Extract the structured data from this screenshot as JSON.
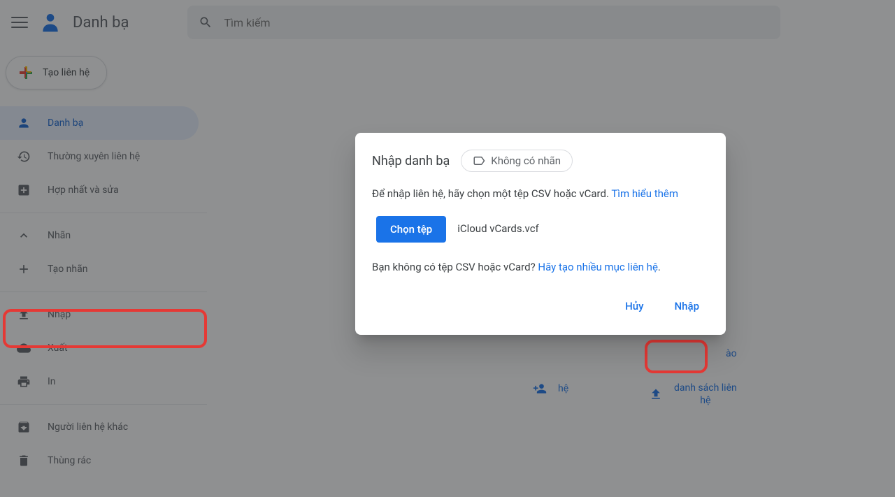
{
  "header": {
    "app_title": "Danh bạ",
    "search_placeholder": "Tìm kiếm"
  },
  "sidebar": {
    "create_label": "Tạo liên hệ",
    "items": {
      "contacts": "Danh bạ",
      "frequent": "Thường xuyên liên hệ",
      "merge": "Hợp nhất và sửa",
      "labels": "Nhãn",
      "create_label": "Tạo nhãn",
      "import": "Nhập",
      "export": "Xuất",
      "print": "In",
      "other": "Người liên hệ khác",
      "trash": "Thùng rác"
    }
  },
  "dialog": {
    "title": "Nhập danh bạ",
    "no_label_chip": "Không có nhãn",
    "desc_prefix": "Để nhập liên hệ, hãy chọn một tệp CSV hoặc vCard. ",
    "learn_more": "Tìm hiểu thêm",
    "choose_file_btn": "Chọn tệp",
    "file_name": "iCloud vCards.vcf",
    "no_file_prefix": "Bạn không có tệp CSV hoặc vCard? ",
    "create_multiple": "Hãy tạo nhiều mục liên hệ",
    "period": ".",
    "cancel": "Hủy",
    "import": "Nhập"
  },
  "background_actions": {
    "something_he": "hệ",
    "ao": "ào",
    "import_list_1": "danh sách liên",
    "import_list_2": "hệ"
  }
}
